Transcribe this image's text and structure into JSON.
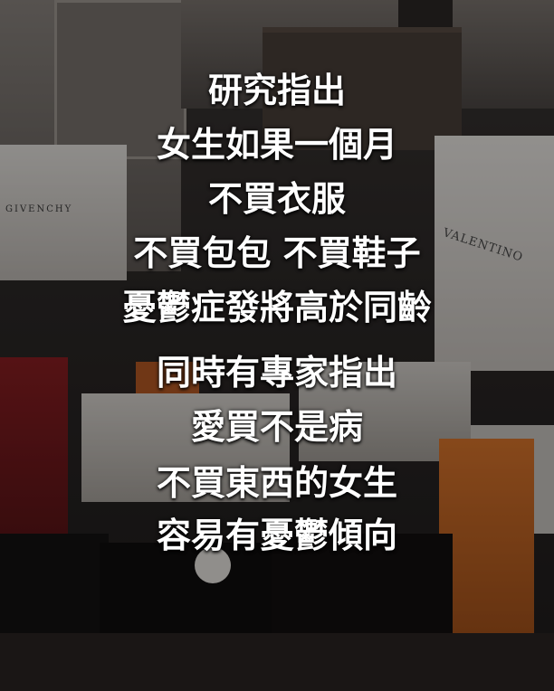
{
  "background": {
    "description_colors": {
      "overlay": "#000000",
      "text": "#ffffff",
      "bag_red": "#8a1e22",
      "bag_orange": "#d9752c"
    },
    "brand_logos": {
      "left_bag": "GIVENCHY",
      "right_bag": "VALENTINO"
    }
  },
  "caption": {
    "lines": [
      "研究指出",
      "女生如果一個月",
      "不買衣服",
      "不買包包 不買鞋子",
      "憂鬱症發將高於同齡",
      "同時有專家指出",
      "愛買不是病",
      "不買東西的女生",
      "容易有憂鬱傾向"
    ]
  }
}
